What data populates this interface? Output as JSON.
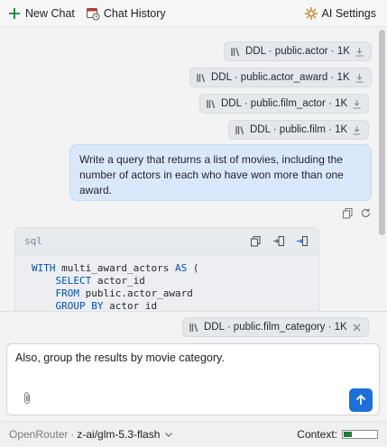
{
  "toolbar": {
    "new_chat": "New Chat",
    "chat_history": "Chat History",
    "ai_settings": "AI Settings"
  },
  "context_chips": [
    {
      "label": "DDL · public.actor · 1K"
    },
    {
      "label": "DDL · public.actor_award · 1K"
    },
    {
      "label": "DDL · public.film_actor · 1K"
    },
    {
      "label": "DDL · public.film · 1K"
    }
  ],
  "user_message": {
    "line1": "Write a query that returns a list of movies, including the",
    "line2": "number of actors in each who have won more than one",
    "line3": "award."
  },
  "code_block": {
    "language": "sql",
    "lines": [
      "WITH multi_award_actors AS (",
      "    SELECT actor_id",
      "    FROM public.actor_award",
      "    GROUP BY actor_id"
    ]
  },
  "composer": {
    "attached_chip": "DDL · public.film_category · 1K",
    "input_value": "Also, group the results by movie category."
  },
  "status": {
    "provider": "OpenRouter",
    "separator": "·",
    "model": "z-ai/glm-5.3-flash",
    "context_label": "Context:",
    "context_fraction": 0.25
  },
  "colors": {
    "accent": "#1e6fd9",
    "user_bubble": "#d9e8fb",
    "context_fill": "#1a7f37",
    "plus_icon": "#1a7f37",
    "settings_icon": "#c8851c"
  }
}
